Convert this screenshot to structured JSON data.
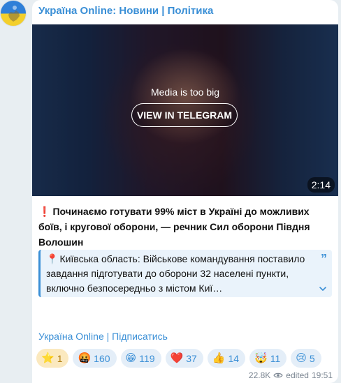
{
  "channel": {
    "name": "Україна Online: Новини | Політика",
    "avatar_icon": "ukraine-flag-avatar"
  },
  "media": {
    "notice": "Media is too big",
    "button_label": "VIEW IN TELEGRAM",
    "duration": "2:14"
  },
  "post": {
    "headline_icon": "❗",
    "headline": "Починаємо готувати 99% міст в Україні до можливих боїв, і кругової оборони, — речник Сил оборони Півдня Волошин"
  },
  "quote": {
    "icon": "📍",
    "text": "Київська область: Військове командування поставило завдання підготувати до оборони 32 населені пункти, включно безпосередньо з містом Киї…",
    "quote_mark": "”"
  },
  "subscribe_link": "Україна Online | Підписатись",
  "reactions": [
    {
      "emoji": "⭐",
      "count": "1",
      "chosen": true
    },
    {
      "emoji": "🤬",
      "count": "160"
    },
    {
      "emoji": "😁",
      "count": "119"
    },
    {
      "emoji": "❤️",
      "count": "37"
    },
    {
      "emoji": "👍",
      "count": "14"
    },
    {
      "emoji": "🤯",
      "count": "11"
    },
    {
      "emoji": "😢",
      "count": "5"
    }
  ],
  "meta": {
    "views": "22.8K",
    "edited_label": "edited",
    "time": "19:51"
  },
  "colors": {
    "accent": "#3a8fd6",
    "bubble_bg": "#ffffff",
    "page_bg": "#e8eef2"
  }
}
